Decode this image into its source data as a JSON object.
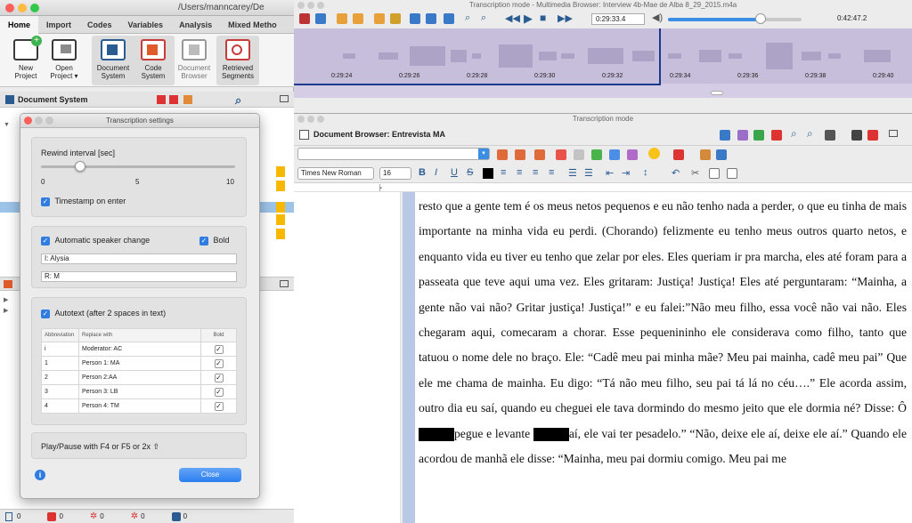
{
  "left_window": {
    "title": "/Users/manncarey/De",
    "tabs": [
      "Home",
      "Import",
      "Codes",
      "Variables",
      "Analysis",
      "Mixed Metho"
    ],
    "ribbon": [
      {
        "label": "New\nProject",
        "icon": "new-project-icon"
      },
      {
        "label": "Open\nProject ▾",
        "icon": "open-project-icon"
      },
      {
        "label": "Document\nSystem",
        "icon": "document-system-icon"
      },
      {
        "label": "Code\nSystem",
        "icon": "code-system-icon"
      },
      {
        "label": "Document\nBrowser",
        "icon": "document-browser-icon"
      },
      {
        "label": "Retrieved\nSegments",
        "icon": "retrieved-segments-icon"
      }
    ],
    "document_system_title": "Document System",
    "status_counts": [
      "0",
      "0",
      "0",
      "0",
      "0"
    ]
  },
  "dialog": {
    "title": "Transcription settings",
    "rewind_label": "Rewind interval [sec]",
    "rewind_value": 2,
    "rewind_min": "0",
    "rewind_mid": "5",
    "rewind_max": "10",
    "timestamp_label": "Timestamp on enter",
    "speaker_change_label": "Automatic speaker change",
    "bold_label": "Bold",
    "speaker1": "I: Alysia",
    "speaker2": "R: M",
    "autotext_label": "Autotext (after 2 spaces in text)",
    "table_headers": [
      "Abbreviation",
      "Replace with",
      "Bold"
    ],
    "table_rows": [
      {
        "abbr": "i",
        "replace": "Moderator: AC",
        "bold": "✓"
      },
      {
        "abbr": "1",
        "replace": "Person 1: MA",
        "bold": "✓"
      },
      {
        "abbr": "2",
        "replace": "Person 2:AA",
        "bold": "✓"
      },
      {
        "abbr": "3",
        "replace": "Person 3: LB",
        "bold": "✓"
      },
      {
        "abbr": "4",
        "replace": "Person 4: TM",
        "bold": "✓"
      }
    ],
    "play_pause_label": "Play/Pause with F4 or F5 or 2x ⇧",
    "close_label": "Close"
  },
  "media_player": {
    "title": "Transcription mode - Multimedia Browser:  Interview 4b-Mae de Alba 8_29_2015.m4a",
    "current_time": "0:29:33.4",
    "total_time": "0:42:47.2",
    "progress": 0.69,
    "timeline_labels": [
      "0:29:24",
      "0:29:26",
      "0:29:28",
      "0:29:30",
      "0:29:32",
      "0:29:34",
      "0:29:36",
      "0:29:38",
      "0:29:40"
    ]
  },
  "doc_browser": {
    "window_title": "Transcription mode",
    "title": "Document Browser: Entrevista MA",
    "font_name": "Times New Roman",
    "font_size": "16",
    "format_buttons": [
      "B",
      "I",
      "U",
      "S"
    ],
    "paragraphs": [
      "resto que a gente tem é os meus netos pequenos e eu não tenho nada a perder, o que eu tinha de mais importante na minha vida eu perdi. (Chorando) felizmente eu tenho meus outros quarto netos, e enquanto vida eu tiver eu tenho que zelar por eles. Eles queriam ir pra marcha, eles até foram para a passeata que teve aqui uma vez. Eles gritaram: Justiça! Justiça! Eles até perguntaram: “Mainha, a gente não vai não? Gritar justiça! Justiça!” e eu falei:”Não meu filho, essa você não vai não. Eles chegaram aqui, comecaram a chorar. Esse pequenininho ele considerava como filho, tanto que tatuou o nome dele no braço. Ele: “Cadê meu pai minha mãe? Meu pai mainha, cadê meu pai”  Que ele me chama de mainha. Eu digo: “Tá não meu filho, seu pai tá lá no céu….” Ele acorda assim, outro dia eu saí, quando eu cheguei ele tava dormindo do mesmo jeito que ele dormia né? Disse: Ô ",
      "pegue e levante",
      "aí, ele vai ter pesadelo.” “Não, deixe ele aí, deixe ele aí.” Quando ele acordou de manhã ele disse: “Mainha, meu pai dormiu comigo. Meu pai me"
    ]
  }
}
